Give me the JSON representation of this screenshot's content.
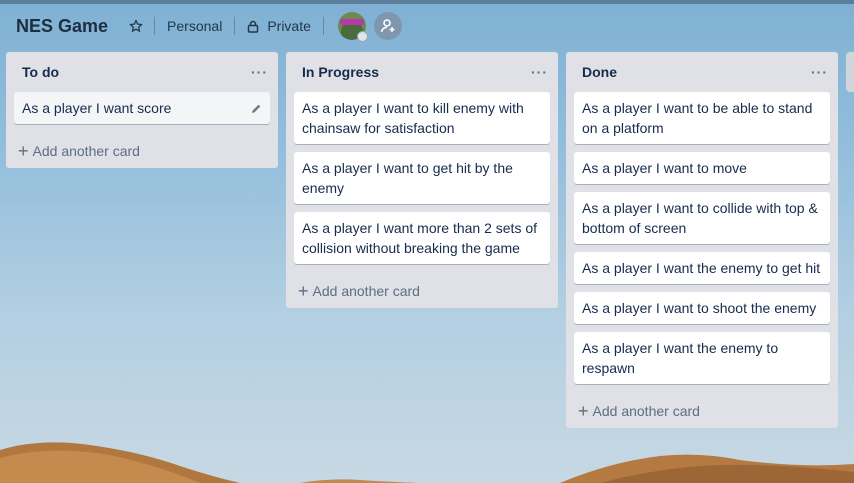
{
  "board": {
    "title": "NES Game",
    "team": "Personal",
    "visibility": "Private"
  },
  "icons": {
    "star": "star-icon",
    "lock": "lock-icon",
    "invite": "add-member-icon",
    "edit": "pencil-icon"
  },
  "lists": [
    {
      "title": "To do",
      "menu": "···",
      "cards": [
        "As a player I want score"
      ],
      "add_label": "Add another card"
    },
    {
      "title": "In Progress",
      "menu": "···",
      "cards": [
        "As a player I want to kill enemy with chainsaw for satisfaction",
        "As a player I want to get hit by the enemy",
        "As a player I want more than 2 sets of collision without breaking the game"
      ],
      "add_label": "Add another card"
    },
    {
      "title": "Done",
      "menu": "···",
      "cards": [
        "As a player I want to be able to stand on a platform",
        "As a player I want to move",
        "As a player I want to collide with top & bottom of screen",
        "As a player I want the enemy to get hit",
        "As a player I want to shoot the enemy",
        "As a player I want the enemy to respawn"
      ],
      "add_label": "Add another card"
    }
  ],
  "colors": {
    "list_bg": "#dfe1e6",
    "card_bg": "#ffffff",
    "text": "#172b4d",
    "muted": "#5e6c84"
  }
}
